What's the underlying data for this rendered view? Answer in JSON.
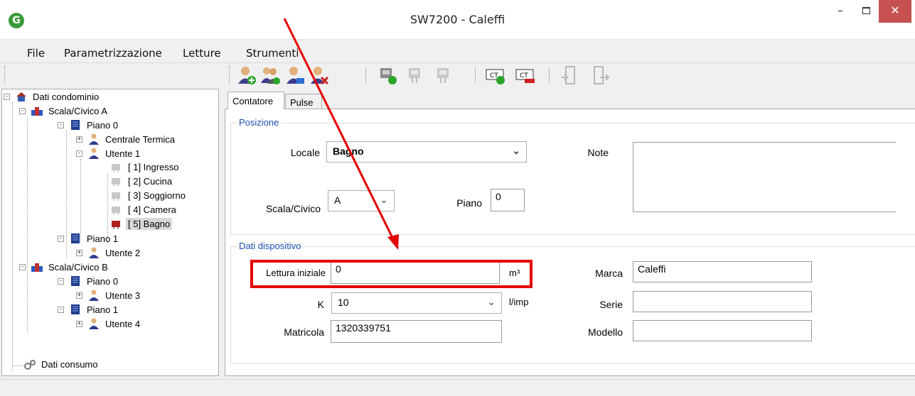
{
  "window": {
    "title": "SW7200 - Caleffi",
    "minimize_glyph": "–",
    "close_glyph": "✕",
    "app_icon_glyph": "G"
  },
  "menu": [
    "File",
    "Parametrizzazione",
    "Letture",
    "Strumenti"
  ],
  "toolbar": {
    "icons": [
      "add-user-icon",
      "add-users-icon",
      "edit-user-icon",
      "delete-user-icon",
      "add-meter-icon",
      "meter-icon",
      "meter-disabled-icon",
      "add-ct-icon",
      "remove-ct-icon",
      "door-icon",
      "door-out-icon"
    ]
  },
  "tree": {
    "root": "Dati condominio",
    "scala_a": "Scala/Civico A",
    "piano_a0": "Piano  0",
    "centrale": "Centrale Termica",
    "utente1": "Utente 1",
    "room1": "[  1] Ingresso",
    "room2": "[  2] Cucina",
    "room3": "[  3] Soggiorno",
    "room4": "[  4] Camera",
    "room5": "[  5] Bagno",
    "piano_a1": "Piano  1",
    "utente2": "Utente 2",
    "scala_b": "Scala/Civico B",
    "piano_b0": "Piano  0",
    "utente3": "Utente 3",
    "piano_b1": "Piano  1",
    "utente4": "Utente 4",
    "consumo": "Dati consumo"
  },
  "tabs": {
    "contatore": "Contatore",
    "pulse": "Pulse"
  },
  "posizione": {
    "legend": "Posizione",
    "locale_label": "Locale",
    "locale_value": "Bagno",
    "note_label": "Note",
    "note_value": "",
    "scala_label": "Scala/Civico",
    "scala_value": "A",
    "piano_label": "Piano",
    "piano_value": "0"
  },
  "dispositivo": {
    "legend": "Dati dispositivo",
    "lettura_label": "Lettura iniziale",
    "lettura_value": "0",
    "lettura_unit": "m³",
    "k_label": "K",
    "k_value": "10",
    "k_unit": "l/imp",
    "matricola_label": "Matricola",
    "matricola_value": "1320339751",
    "marca_label": "Marca",
    "marca_value": "Caleffi",
    "serie_label": "Serie",
    "serie_value": "",
    "modello_label": "Modello",
    "modello_value": ""
  },
  "colors": {
    "highlight": "#e50000",
    "legend_text": "#1a4fb0",
    "close_button": "#c75050"
  }
}
